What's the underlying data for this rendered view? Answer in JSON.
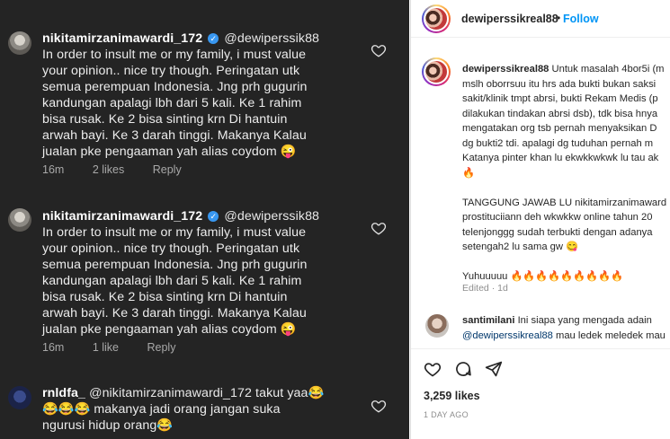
{
  "comments": [
    {
      "username": "nikitamirzanimawardi_172",
      "mention": "@dewiperssik88",
      "lines": [
        "In order to insult me or my family, i must value",
        "your opinion.. nice try though. Peringatan utk",
        "semua perempuan Indonesia. Jng prh gugurin",
        "kandungan apalagi lbh dari 5 kali. Ke 1 rahim",
        "bisa rusak. Ke 2 bisa sinting krn Di hantuin",
        "arwah bayi. Ke 3 darah tinggi. Makanya Kalau",
        "jualan pke pengaaman yah alias coydom 😜"
      ],
      "time": "16m",
      "likes": "2 likes",
      "reply": "Reply"
    },
    {
      "username": "nikitamirzanimawardi_172",
      "mention": "@dewiperssik88",
      "lines": [
        "In order to insult me or my family, i must value",
        "your opinion.. nice try though. Peringatan utk",
        "semua perempuan Indonesia. Jng prh gugurin",
        "kandungan apalagi lbh dari 5 kali. Ke 1 rahim",
        "bisa rusak. Ke 2 bisa sinting krn Di hantuin",
        "arwah bayi. Ke 3 darah tinggi. Makanya Kalau",
        "jualan pke pengaaman yah alias coydom 😜"
      ],
      "time": "16m",
      "likes": "1 like",
      "reply": "Reply"
    },
    {
      "username": "rnldfa_",
      "mention": "@nikitamirzanimawardi_172",
      "lines": [
        "takut yaa😂",
        "😂😂😂 makanya jadi orang jangan suka",
        "ngurusi hidup orang😂"
      ]
    }
  ],
  "post": {
    "username": "dewiperssikreal88",
    "separator": "•",
    "follow": "Follow",
    "caption_lines": [
      "Untuk masalah 4bor5i (m",
      "mslh oborrsuu itu hrs ada bukti bukan saksi",
      "sakit/klinik tmpt abrsi, bukti Rekam Medis (p",
      "dilakukan tindakan abrsi dsb), tdk bisa hnya",
      "mengatakan org tsb pernah menyaksikan D",
      "dg bukti2 tdi. apalagi dg tuduhan pernah m",
      "Katanya pinter khan lu ekwkkwkwk lu tau ak",
      "🔥",
      "",
      "TANGGUNG JAWAB LU nikitamirzanimaward",
      "prostituciiann deh wkwkkw online tahun 20",
      "telenjonggg sudah terbukti dengan adanya",
      "setengah2 lu sama gw 😋",
      "",
      "Yuhuuuuu 🔥🔥🔥🔥🔥🔥🔥🔥🔥"
    ],
    "edited": "Edited · 1d",
    "reply_comment": {
      "username": "santimilani",
      "line1": "Ini siapa yang mengada adain",
      "mention": "@dewiperssikreal88",
      "line2_rest": "mau ledek meledek mau"
    },
    "likes": "3,259 likes",
    "time_ago": "1 DAY AGO"
  },
  "colors": {
    "left_bg": "#242424",
    "link_blue": "#0095f6",
    "verified_blue": "#3897f0"
  }
}
